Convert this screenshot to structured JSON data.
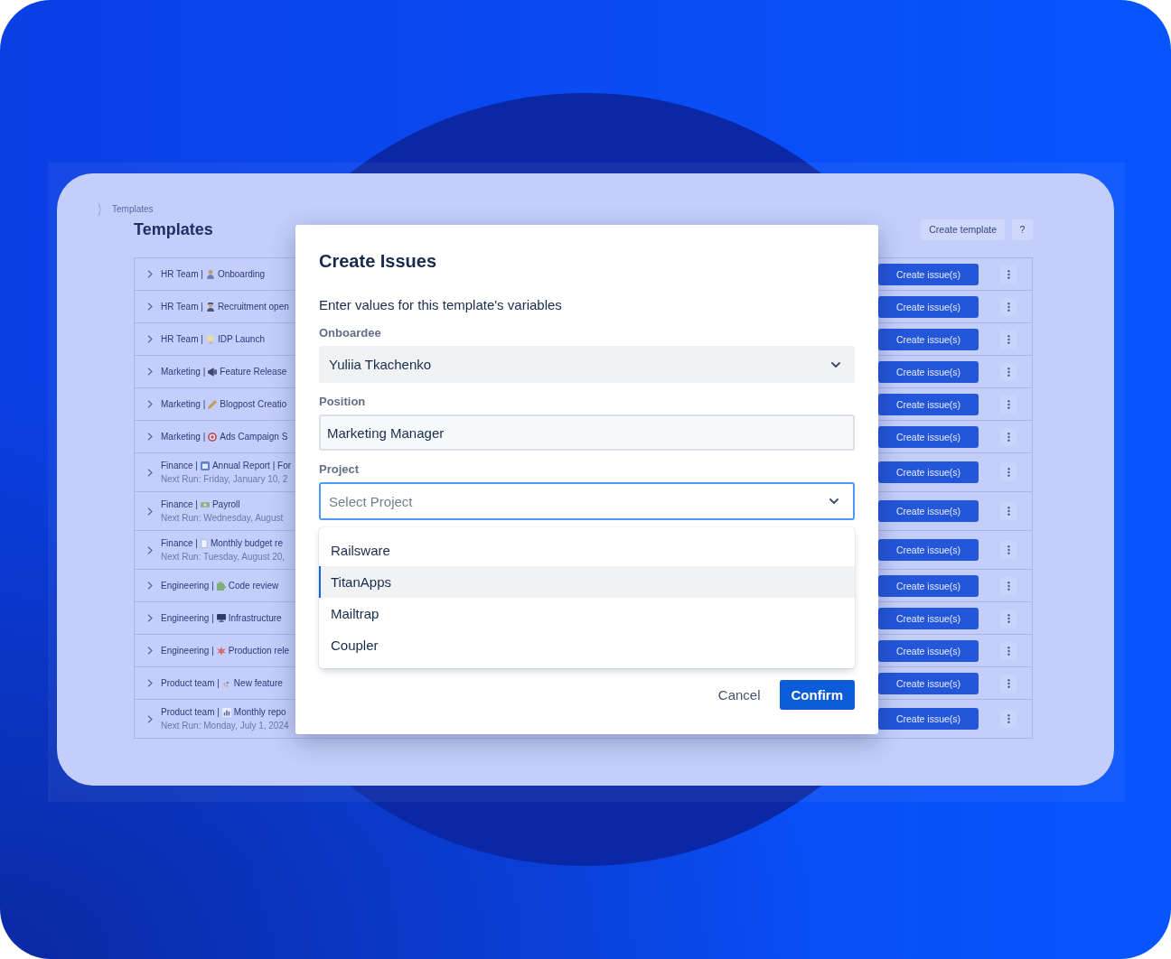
{
  "breadcrumb": "Templates",
  "title": "Templates",
  "header_actions": [
    {
      "kind": "secondary",
      "label": "Create template"
    },
    {
      "kind": "help",
      "label": "?"
    }
  ],
  "templates": [
    {
      "team": "HR Team |",
      "name": "Onboarding",
      "action": "Create issue(s)"
    },
    {
      "team": "HR Team |",
      "name": "Recruitment open",
      "action": "Create issue(s)"
    },
    {
      "team": "HR Team |",
      "name": "IDP Launch",
      "action": "Create issue(s)"
    },
    {
      "team": "Marketing |",
      "name": "Feature Release",
      "action": "Create issue(s)"
    },
    {
      "team": "Marketing |",
      "name": "Blogpost Creatio",
      "action": "Create issue(s)"
    },
    {
      "team": "Marketing |",
      "name": "Ads Campaign S",
      "action": "Create issue(s)"
    },
    {
      "team": "Finance |",
      "name": "Annual Report | For",
      "next_run": "Next Run: Friday, January 10, 2",
      "action": "Create issue(s)"
    },
    {
      "team": "Finance |",
      "name": "Payroll",
      "next_run": "Next Run: Wednesday, August",
      "action": "Create issue(s)"
    },
    {
      "team": "Finance |",
      "name": "Monthly budget re",
      "next_run": "Next Run: Tuesday, August 20,",
      "action": "Create issue(s)"
    },
    {
      "team": "Engineering |",
      "name": "Code review",
      "action": "Create issue(s)"
    },
    {
      "team": "Engineering |",
      "name": "Infrastructure",
      "action": "Create issue(s)"
    },
    {
      "team": "Engineering |",
      "name": "Production rele",
      "action": "Create issue(s)"
    },
    {
      "team": "Product team |",
      "name": "New feature",
      "action": "Create issue(s)"
    },
    {
      "team": "Product team |",
      "name": "Monthly repo",
      "next_run": "Next Run: Monday, July 1, 2024",
      "action": "Create issue(s)"
    }
  ],
  "dialog": {
    "title": "Create Issues",
    "intro": "Enter values for this template's variables",
    "fields": [
      {
        "kind": "select",
        "label": "Onboardee",
        "value": "Yuliia Tkachenko",
        "expanded": false
      },
      {
        "kind": "text",
        "label": "Position",
        "value": "Marketing Manager"
      },
      {
        "kind": "select",
        "label": "Project",
        "placeholder": "Select Project",
        "expanded": true,
        "options": [
          {
            "label": "Railsware",
            "selected": false
          },
          {
            "label": "TitanApps",
            "selected": true
          },
          {
            "label": "Mailtrap",
            "selected": false
          },
          {
            "label": "Coupler",
            "selected": false
          }
        ]
      }
    ],
    "buttons": [
      {
        "kind": "subtle",
        "label": "Cancel"
      },
      {
        "kind": "primary",
        "label": "Confirm"
      }
    ]
  }
}
